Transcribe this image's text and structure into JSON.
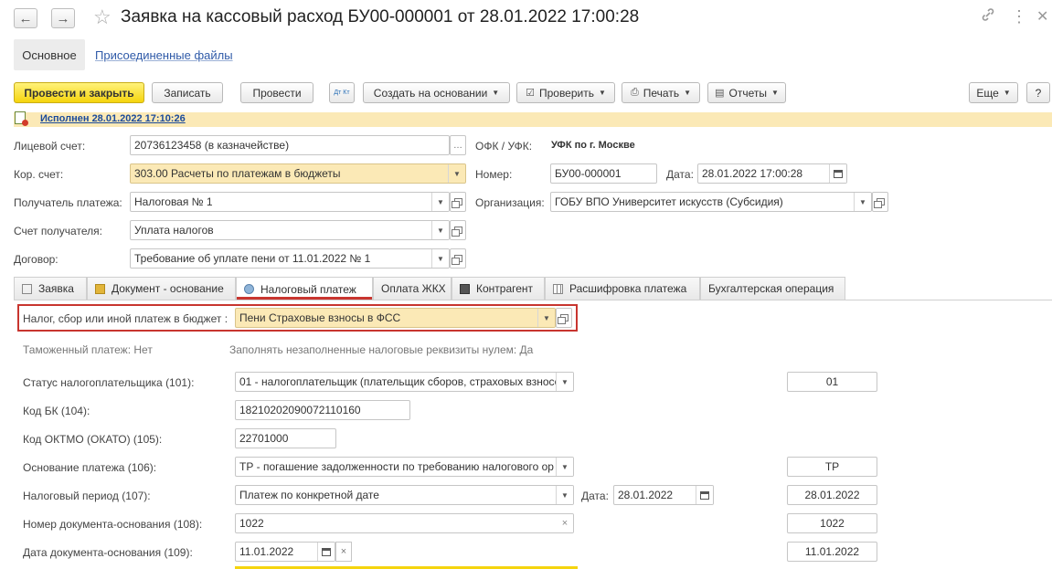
{
  "window": {
    "title": "Заявка на кассовый расход БУ00-000001 от 28.01.2022 17:00:28",
    "back_glyph": "←",
    "forward_glyph": "→",
    "star_glyph": "☆",
    "link_glyph": "🔗",
    "more_glyph": "⋮",
    "close_glyph": "✕"
  },
  "form_tabs": {
    "main": "Основное",
    "files": "Присоединенные файлы"
  },
  "toolbar": {
    "post_close": "Провести и закрыть",
    "save": "Записать",
    "post": "Провести",
    "create_based": "Создать на основании",
    "check": "Проверить",
    "print": "Печать",
    "reports": "Отчеты",
    "more": "Еще",
    "help": "?",
    "dt_kt": "Дт Кт"
  },
  "status": {
    "text": "Исполнен 28.01.2022 17:10:26"
  },
  "header_fields": {
    "personal_account_label": "Лицевой счет:",
    "personal_account_value": "20736123458 (в казначействе)",
    "cor_account_label": "Кор. счет:",
    "cor_account_value": "303.00 Расчеты по платежам в бюджеты",
    "recipient_label": "Получатель платежа:",
    "recipient_value": "Налоговая № 1",
    "recipient_account_label": "Счет получателя:",
    "recipient_account_value": "Уплата налогов",
    "contract_label": "Договор:",
    "contract_value": "Требование об уплате пени от 11.01.2022 № 1",
    "ofk_label": "ОФК / УФК:",
    "ofk_value": "УФК по г. Москве",
    "number_label": "Номер:",
    "number_value": "БУ00-000001",
    "date_label": "Дата:",
    "date_value": "28.01.2022 17:00:28",
    "org_label": "Организация:",
    "org_value": "ГОБУ ВПО Университет искусств (Субсидия)"
  },
  "tabs": [
    {
      "label": "Заявка"
    },
    {
      "label": "Документ - основание"
    },
    {
      "label": "Налоговый платеж"
    },
    {
      "label": "Оплата ЖКХ"
    },
    {
      "label": "Контрагент"
    },
    {
      "label": "Расшифровка платежа"
    },
    {
      "label": "Бухгалтерская операция"
    }
  ],
  "tax": {
    "payment_label": "Налог, сбор или иной платеж в бюджет :",
    "payment_value": "Пени Страховые взносы в ФСС",
    "customs": "Таможенный платеж: Нет",
    "fill_zero": "Заполнять незаполненные налоговые реквизиты нулем: Да",
    "status_label": "Статус налогоплательщика (101):",
    "status_value": "01 - налогоплательщик (плательщик сборов, страховых взносо",
    "status_code": "01",
    "kbk_label": "Код БК (104):",
    "kbk_value": "18210202090072110160",
    "oktmo_label": "Код ОКТМО (ОКАТО) (105):",
    "oktmo_value": "22701000",
    "basis_label": "Основание платежа (106):",
    "basis_value": "ТР - погашение задолженности по требованию налогового ор",
    "basis_code": "ТР",
    "period_label": "Налоговый период (107):",
    "period_value": "Платеж по конкретной дате",
    "period_date_label": "Дата:",
    "period_date_value": "28.01.2022",
    "period_code": "28.01.2022",
    "doc_num_label": "Номер документа-основания (108):",
    "doc_num_value": "1022",
    "doc_num_code": "1022",
    "doc_date_label": "Дата документа-основания (109):",
    "doc_date_value": "11.01.2022",
    "doc_date_code": "11.01.2022"
  },
  "colors": {
    "accent_yellow": "#f5d40e",
    "highlight_red": "#c8352f",
    "field_yellow": "#fbe9b6"
  }
}
